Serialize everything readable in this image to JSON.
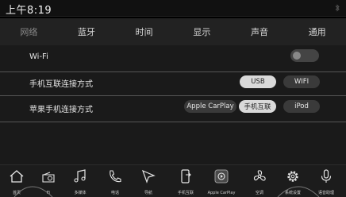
{
  "status": {
    "time": "上午8:19"
  },
  "tabs": [
    {
      "label": "网络",
      "active": true
    },
    {
      "label": "蓝牙",
      "active": false
    },
    {
      "label": "时间",
      "active": false
    },
    {
      "label": "显示",
      "active": false
    },
    {
      "label": "声音",
      "active": false
    },
    {
      "label": "通用",
      "active": false
    }
  ],
  "wifi": {
    "label": "Wi-Fi",
    "enabled": false
  },
  "phone_connect": {
    "label": "手机互联连接方式",
    "options": [
      "USB",
      "WIFI"
    ],
    "selected": "USB"
  },
  "apple_connect": {
    "label": "苹果手机连接方式",
    "options": [
      "Apple CarPlay",
      "手机互联",
      "iPod"
    ],
    "selected": "手机互联"
  },
  "dock": {
    "items": [
      {
        "label": "首页",
        "icon": "home-icon"
      },
      {
        "label": "Fi",
        "icon": "radio-icon"
      },
      {
        "label": "多媒体",
        "icon": "music-note-icon"
      },
      {
        "label": "电话",
        "icon": "phone-icon"
      },
      {
        "label": "导航",
        "icon": "navigation-arrow-icon"
      },
      {
        "label": "手机互联",
        "icon": "phone-link-icon"
      },
      {
        "label": "Apple CarPlay",
        "icon": "carplay-icon"
      },
      {
        "label": "空调",
        "icon": "fan-icon"
      },
      {
        "label": "系统设置",
        "icon": "gear-icon"
      },
      {
        "label": "语音助理",
        "icon": "microphone-icon"
      }
    ]
  },
  "colors": {
    "selected_pill": "#d9d9d9",
    "pill": "#3a3a3a",
    "tabbar": "#222222"
  }
}
